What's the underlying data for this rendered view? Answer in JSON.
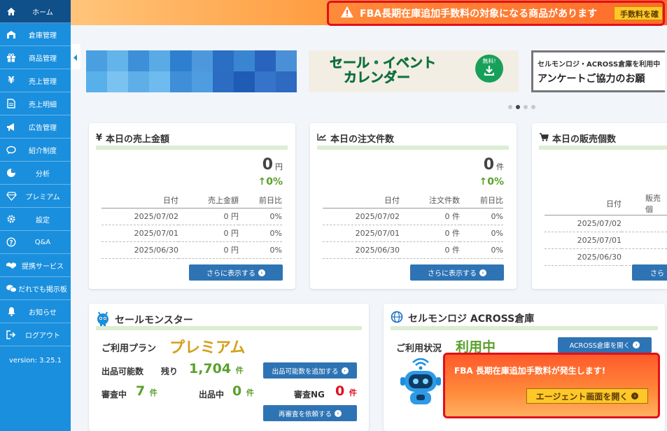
{
  "sidebar": {
    "items": [
      {
        "label": "ホーム",
        "icon": "home-icon"
      },
      {
        "label": "倉庫管理",
        "icon": "warehouse-icon"
      },
      {
        "label": "商品管理",
        "icon": "gift-icon"
      },
      {
        "label": "売上管理",
        "icon": "yen-icon"
      },
      {
        "label": "売上明細",
        "icon": "document-icon"
      },
      {
        "label": "広告管理",
        "icon": "megaphone-icon"
      },
      {
        "label": "紹介制度",
        "icon": "speech-bubble-icon"
      },
      {
        "label": "分析",
        "icon": "pie-chart-icon"
      },
      {
        "label": "プレミアム",
        "icon": "diamond-icon"
      },
      {
        "label": "設定",
        "icon": "gear-icon"
      },
      {
        "label": "Q&A",
        "icon": "question-icon"
      },
      {
        "label": "提携サービス",
        "icon": "handshake-icon"
      },
      {
        "label": "だれでも掲示板",
        "icon": "chat-bubbles-icon"
      },
      {
        "label": "お知らせ",
        "icon": "bell-icon"
      },
      {
        "label": "ログアウト",
        "icon": "logout-icon"
      }
    ],
    "version": "version: 3.25.1"
  },
  "topbar": {
    "alert_text": "FBA長期在庫追加手数料の対象になる商品があります",
    "alert_button": "手数料を確"
  },
  "banners": {
    "event_calendar_title_line1": "セール・イベント",
    "event_calendar_title_line2": "カレンダー",
    "event_calendar_badge": "無料!",
    "survey_line1": "セルモンロジ・ACROSS倉庫を利用中",
    "survey_line2": "アンケートご協力のお願"
  },
  "stats": [
    {
      "title": "本日の売上金額",
      "icon": "yen-icon",
      "total": "0",
      "unit": "円",
      "change": "0%",
      "headers": [
        "日付",
        "売上金額",
        "前日比"
      ],
      "rows": [
        [
          "2025/07/02",
          "0 円",
          "0%"
        ],
        [
          "2025/07/01",
          "0 円",
          "0%"
        ],
        [
          "2025/06/30",
          "0 円",
          "0%"
        ]
      ],
      "more": "さらに表示する"
    },
    {
      "title": "本日の注文件数",
      "icon": "line-chart-icon",
      "total": "0",
      "unit": "件",
      "change": "0%",
      "headers": [
        "日付",
        "注文件数",
        "前日比"
      ],
      "rows": [
        [
          "2025/07/02",
          "0 件",
          "0%"
        ],
        [
          "2025/07/01",
          "0 件",
          "0%"
        ],
        [
          "2025/06/30",
          "0 件",
          "0%"
        ]
      ],
      "more": "さらに表示する"
    },
    {
      "title": "本日の販売個数",
      "icon": "cart-icon",
      "total": "",
      "unit": "",
      "change": "",
      "headers": [
        "日付",
        "販売個"
      ],
      "rows": [
        [
          "2025/07/02"
        ],
        [
          "2025/07/01"
        ],
        [
          "2025/06/30"
        ]
      ],
      "more": "さら"
    }
  ],
  "sales_monster": {
    "title": "セールモンスター",
    "plan_label": "ご利用プラン",
    "plan_value": "プレミアム",
    "listable_label": "出品可能数",
    "remaining_label": "残り",
    "remaining_value": "1,704",
    "remaining_unit": "件",
    "add_button": "出品可能数を追加する",
    "review_label": "審査中",
    "review_value": "7",
    "review_unit": "件",
    "listing_label": "出品中",
    "listing_value": "0",
    "listing_unit": "件",
    "ng_label": "審査NG",
    "ng_value": "0",
    "ng_unit": "件",
    "rereview_button": "再審査を依頼する"
  },
  "across": {
    "title": "セルモンロジ ACROSS倉庫",
    "status_label": "ご利用状況",
    "status_value": "利用中",
    "open_button": "ACROSS倉庫を開く",
    "alert_text": "FBA 長期在庫追加手数料が発生します!",
    "agent_button": "エージェント画面を開く"
  }
}
